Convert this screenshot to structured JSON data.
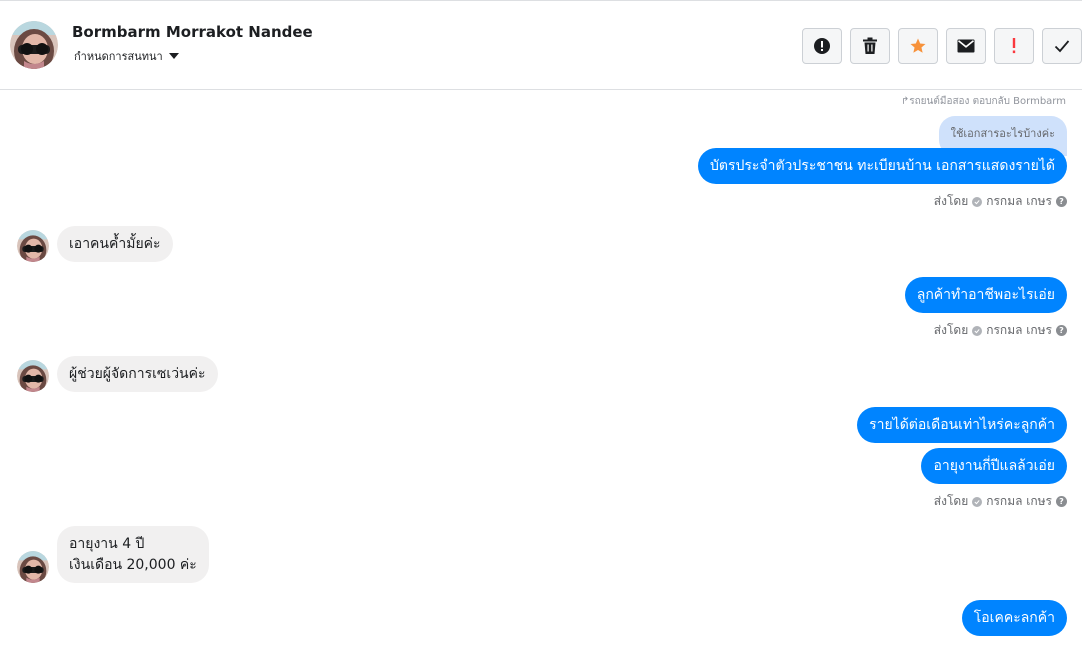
{
  "header": {
    "name": "Bormbarm Morrakot Nandee",
    "subtitle": "กำหนดการสนทนา",
    "tools": [
      {
        "icon": "alert-circle-icon"
      },
      {
        "icon": "trash-icon"
      },
      {
        "icon": "star-icon",
        "color": "#f7923b"
      },
      {
        "icon": "envelope-icon"
      },
      {
        "icon": "exclamation-icon",
        "color": "#fa383e"
      },
      {
        "icon": "checkmark-icon"
      }
    ]
  },
  "conversation": {
    "context_line": "↱รถยนต์มือสอง ตอบกลับ Bormbarm",
    "reply_preview": "ใช้เอกสารอะไรบ้างค่ะ",
    "sent_by_label": "ส่งโดย",
    "sender": "กรกมล เกษร",
    "messages": {
      "m1": "บัตรประจำตัวประชาชน ทะเบียนบ้าน เอกสารแสดงรายได้",
      "m2": "เอาคนค้ำมั้ยค่ะ",
      "m3": "ลูกค้าทำอาชีพอะไรเอ่ย",
      "m4": "ผู้ช่วยผู้จัดการเซเว่นค่ะ",
      "m5": "รายได้ต่อเดือนเท่าไหร่คะลูกค้า",
      "m6": "อายุงานกี่ปีแลล้วเอ่ย",
      "m7_line1": "อายุงาน 4 ปี",
      "m7_line2": "เงินเดือน 20,000 ค่ะ",
      "m8": "โอเคคะลกค้า"
    }
  },
  "colors": {
    "outgoing_bubble": "#0084ff",
    "incoming_bubble": "#f1f0f0",
    "reply_preview_bg": "#cfe1fb",
    "star": "#f7923b",
    "exclamation": "#fa383e"
  }
}
